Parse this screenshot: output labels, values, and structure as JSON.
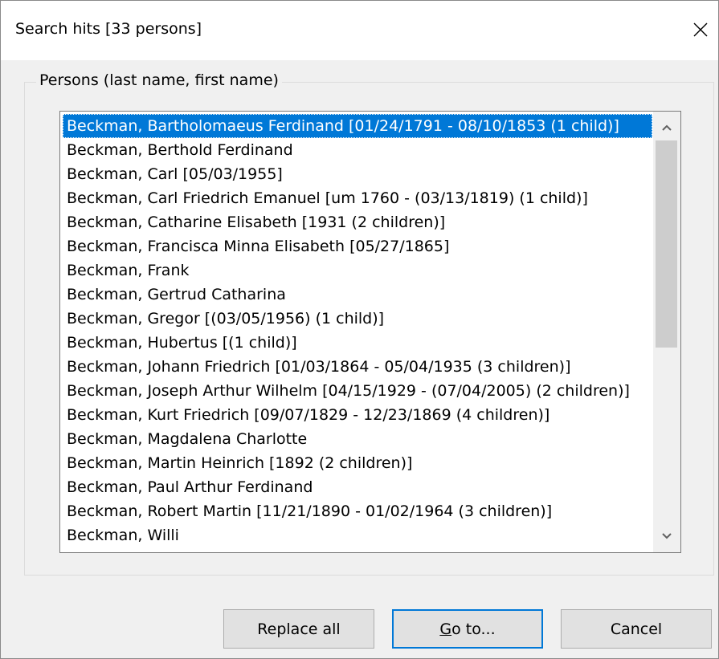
{
  "window": {
    "title": "Search hits [33 persons]",
    "close_icon": "close-icon"
  },
  "group": {
    "legend": "Persons (last name, first name)"
  },
  "list": {
    "selected_index": 0,
    "items": [
      "Beckman, Bartholomaeus Ferdinand [01/24/1791 - 08/10/1853 (1 child)]",
      "Beckman, Berthold Ferdinand",
      "Beckman, Carl [05/03/1955]",
      "Beckman, Carl Friedrich Emanuel [um 1760 - (03/13/1819) (1 child)]",
      "Beckman, Catharine Elisabeth [1931 (2 children)]",
      "Beckman, Francisca Minna Elisabeth [05/27/1865]",
      "Beckman, Frank",
      "Beckman, Gertrud Catharina",
      "Beckman, Gregor [(03/05/1956) (1 child)]",
      "Beckman, Hubertus [(1 child)]",
      "Beckman, Johann Friedrich [01/03/1864 - 05/04/1935 (3 children)]",
      "Beckman, Joseph Arthur Wilhelm [04/15/1929 - (07/04/2005) (2 children)]",
      "Beckman, Kurt Friedrich [09/07/1829 - 12/23/1869 (4 children)]",
      "Beckman, Magdalena Charlotte",
      "Beckman, Martin Heinrich [1892 (2 children)]",
      "Beckman, Paul Arthur Ferdinand",
      "Beckman, Robert Martin [11/21/1890 - 01/02/1964 (3 children)]",
      "Beckman, Willi"
    ],
    "scrollbar": {
      "up_icon": "chevron-up-icon",
      "down_icon": "chevron-down-icon"
    }
  },
  "buttons": {
    "replace_all": "Replace all",
    "goto_mnemonic": "G",
    "goto_rest": "o to...",
    "cancel": "Cancel"
  },
  "colors": {
    "selection": "#0078d7",
    "default_button_border": "#0078d7"
  }
}
